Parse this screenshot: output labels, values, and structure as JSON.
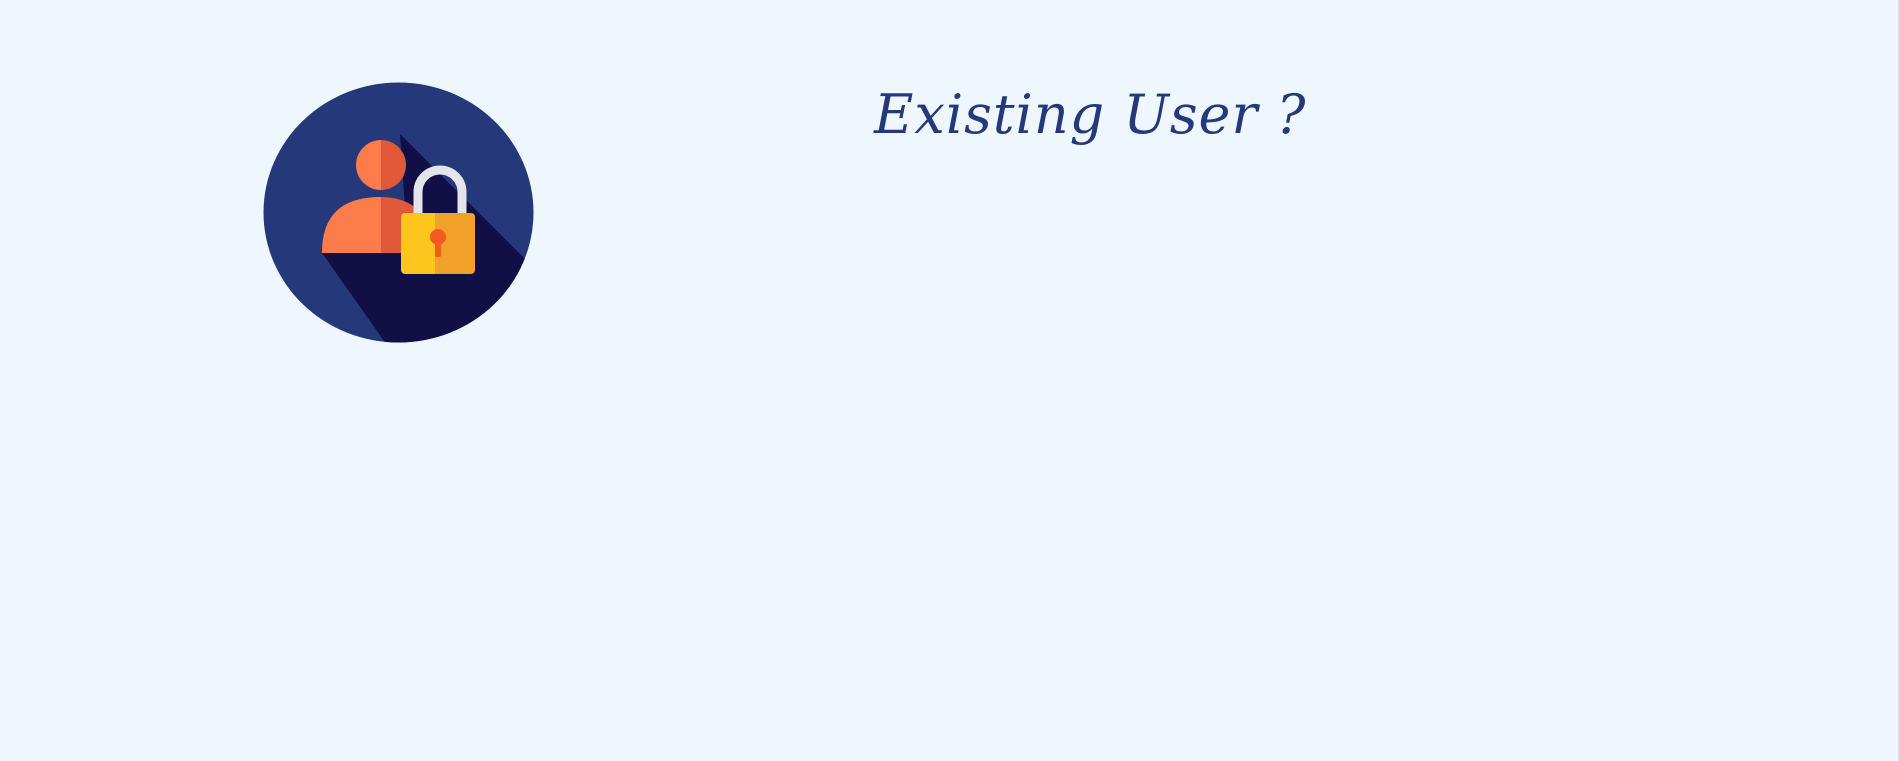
{
  "page": {
    "background": "#eff7fe",
    "heading": "Existing User ?"
  },
  "emblem": {
    "icon": "user-lock-icon",
    "colors": {
      "circle": "#25387a",
      "shadow": "#120f46",
      "person_light": "#fd7c4b",
      "person_dark": "#e2593a",
      "shackle": "#e4e4ea",
      "lock_light": "#ffc51f",
      "lock_dark": "#efa227",
      "keyhole": "#f45a1f"
    }
  },
  "heading_color": "#23397a"
}
